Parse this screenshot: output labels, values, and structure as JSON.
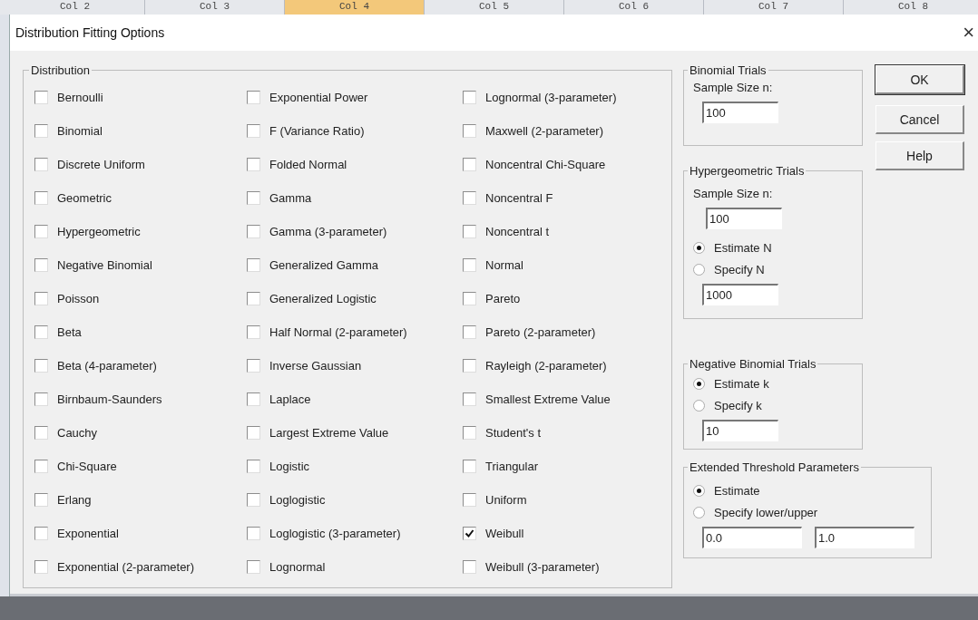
{
  "sheet_header": [
    {
      "label": "Col 2",
      "selected": false
    },
    {
      "label": "Col 3",
      "selected": false
    },
    {
      "label": "Col 4",
      "selected": true
    },
    {
      "label": "Col 5",
      "selected": false
    },
    {
      "label": "Col 6",
      "selected": false
    },
    {
      "label": "Col 7",
      "selected": false
    },
    {
      "label": "Col 8",
      "selected": false
    }
  ],
  "dialog": {
    "title": "Distribution Fitting Options",
    "close": "×"
  },
  "distribution": {
    "title": "Distribution",
    "columns": [
      [
        {
          "label": "Bernoulli",
          "checked": false
        },
        {
          "label": "Binomial",
          "checked": false
        },
        {
          "label": "Discrete Uniform",
          "checked": false
        },
        {
          "label": "Geometric",
          "checked": false
        },
        {
          "label": "Hypergeometric",
          "checked": false
        },
        {
          "label": "Negative Binomial",
          "checked": false
        },
        {
          "label": "Poisson",
          "checked": false
        },
        {
          "label": "Beta",
          "checked": false
        },
        {
          "label": "Beta (4-parameter)",
          "checked": false
        },
        {
          "label": "Birnbaum-Saunders",
          "checked": false
        },
        {
          "label": "Cauchy",
          "checked": false
        },
        {
          "label": "Chi-Square",
          "checked": false
        },
        {
          "label": "Erlang",
          "checked": false
        },
        {
          "label": "Exponential",
          "checked": false
        },
        {
          "label": "Exponential (2-parameter)",
          "checked": false
        }
      ],
      [
        {
          "label": "Exponential Power",
          "checked": false
        },
        {
          "label": "F (Variance Ratio)",
          "checked": false
        },
        {
          "label": "Folded Normal",
          "checked": false
        },
        {
          "label": "Gamma",
          "checked": false
        },
        {
          "label": "Gamma (3-parameter)",
          "checked": false
        },
        {
          "label": "Generalized Gamma",
          "checked": false
        },
        {
          "label": "Generalized Logistic",
          "checked": false
        },
        {
          "label": "Half Normal (2-parameter)",
          "checked": false
        },
        {
          "label": "Inverse Gaussian",
          "checked": false
        },
        {
          "label": "Laplace",
          "checked": false
        },
        {
          "label": "Largest Extreme Value",
          "checked": false
        },
        {
          "label": "Logistic",
          "checked": false
        },
        {
          "label": "Loglogistic",
          "checked": false
        },
        {
          "label": "Loglogistic (3-parameter)",
          "checked": false
        },
        {
          "label": "Lognormal",
          "checked": false
        }
      ],
      [
        {
          "label": "Lognormal (3-parameter)",
          "checked": false
        },
        {
          "label": "Maxwell (2-parameter)",
          "checked": false
        },
        {
          "label": "Noncentral Chi-Square",
          "checked": false
        },
        {
          "label": "Noncentral F",
          "checked": false
        },
        {
          "label": "Noncentral t",
          "checked": false
        },
        {
          "label": "Normal",
          "checked": false
        },
        {
          "label": "Pareto",
          "checked": false
        },
        {
          "label": "Pareto (2-parameter)",
          "checked": false
        },
        {
          "label": "Rayleigh (2-parameter)",
          "checked": false
        },
        {
          "label": "Smallest Extreme Value",
          "checked": false
        },
        {
          "label": "Student's t",
          "checked": false
        },
        {
          "label": "Triangular",
          "checked": false
        },
        {
          "label": "Uniform",
          "checked": false
        },
        {
          "label": "Weibull",
          "checked": true
        },
        {
          "label": "Weibull (3-parameter)",
          "checked": false
        }
      ]
    ]
  },
  "binomial_trials": {
    "title": "Binomial Trials",
    "label": "Sample Size n:",
    "value": "100"
  },
  "hypergeometric_trials": {
    "title": "Hypergeometric Trials",
    "label": "Sample Size n:",
    "value": "100",
    "options": [
      {
        "label": "Estimate N",
        "selected": true
      },
      {
        "label": "Specify N",
        "selected": false
      }
    ],
    "option_value": "1000"
  },
  "negative_binomial_trials": {
    "title": "Negative Binomial Trials",
    "options": [
      {
        "label": "Estimate k",
        "selected": true
      },
      {
        "label": "Specify k",
        "selected": false
      }
    ],
    "option_value": "10"
  },
  "extended_threshold": {
    "title": "Extended Threshold Parameters",
    "options": [
      {
        "label": "Estimate",
        "selected": true
      },
      {
        "label": "Specify lower/upper",
        "selected": false
      }
    ],
    "lower": "0.0",
    "upper": "1.0"
  },
  "buttons": [
    {
      "label": "OK",
      "kind": "default"
    },
    {
      "label": "Cancel",
      "kind": "normal"
    },
    {
      "label": "Help",
      "kind": "normal"
    }
  ]
}
